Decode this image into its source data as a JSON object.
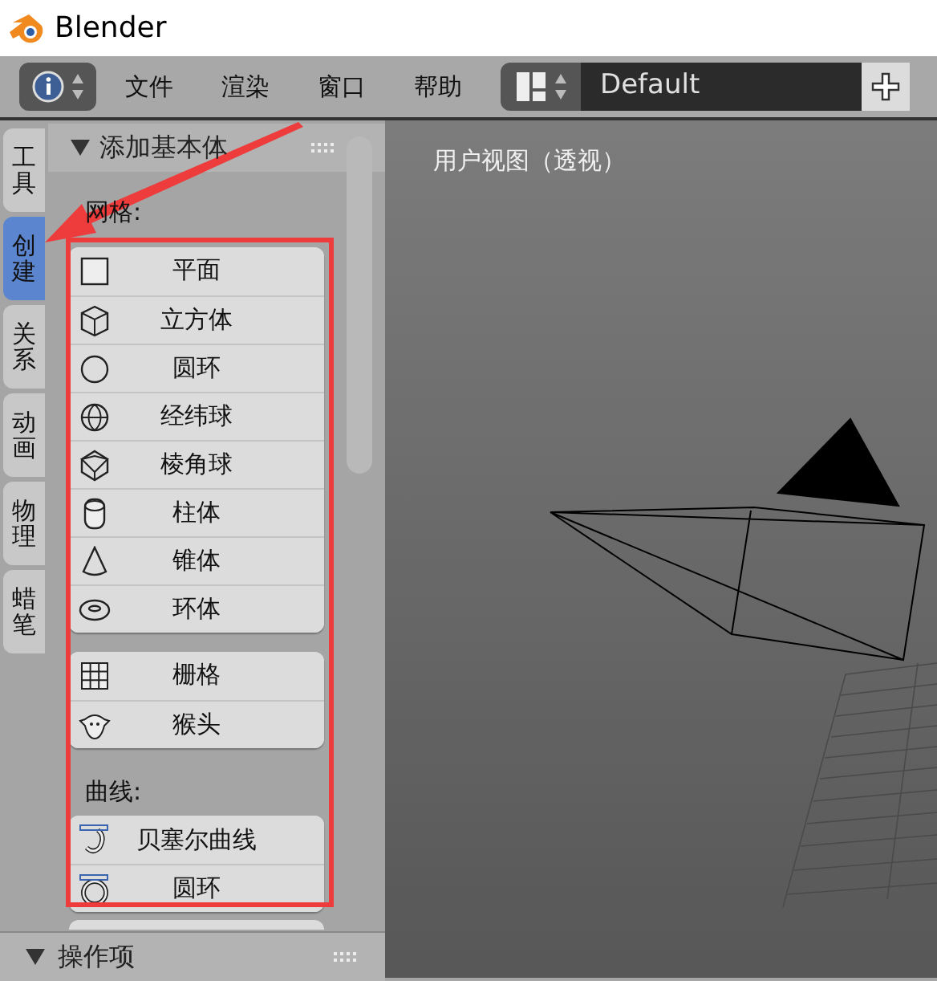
{
  "window": {
    "title": "Blender"
  },
  "menu": [
    "文件",
    "渲染",
    "窗口",
    "帮助"
  ],
  "layout": {
    "value": "Default"
  },
  "tabs": [
    {
      "label": "工具",
      "selected": false
    },
    {
      "label": "创建",
      "selected": true
    },
    {
      "label": "关系",
      "selected": false
    },
    {
      "label": "动画",
      "selected": false
    },
    {
      "label": "物理",
      "selected": false
    },
    {
      "label": "蜡笔",
      "selected": false
    }
  ],
  "panel": {
    "title": "添加基本体",
    "sections": [
      {
        "label": "网格:",
        "groups": [
          [
            "平面",
            "立方体",
            "圆环",
            "经纬球",
            "棱角球",
            "柱体",
            "锥体",
            "环体"
          ],
          [
            "栅格",
            "猴头"
          ]
        ]
      },
      {
        "label": "曲线:",
        "groups": [
          [
            "贝塞尔曲线",
            "圆环"
          ]
        ]
      }
    ]
  },
  "bottom_panel": {
    "title": "操作项"
  },
  "viewport": {
    "label": "用户视图（透视）"
  }
}
